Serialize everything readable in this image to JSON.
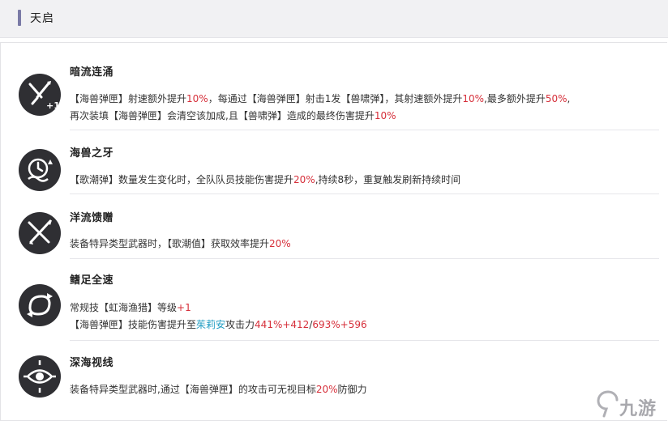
{
  "section": {
    "title": "天启"
  },
  "skills": [
    {
      "name": "暗流连涌",
      "icon": "torpedo-plus-one-icon",
      "lines": [
        [
          [
            "【海兽弹匣】射速额外提升",
            ""
          ],
          [
            "10%",
            "red"
          ],
          [
            "，每通过【海兽弹匣】射击1发【兽啸弹】，其射速额外提升",
            ""
          ],
          [
            "10%",
            "red"
          ],
          [
            ",最多额外提升",
            ""
          ],
          [
            "50%",
            "red"
          ],
          [
            ",",
            ""
          ]
        ],
        [
          [
            "再次装填【海兽弹匣】会清空该加成,且【兽啸弹】造成的最终伤害提升",
            ""
          ],
          [
            "10%",
            "red"
          ]
        ]
      ]
    },
    {
      "name": "海兽之牙",
      "icon": "clock-wave-icon",
      "lines": [
        [
          [
            "【歌潮弹】数量发生变化时，全队队员技能伤害提升",
            ""
          ],
          [
            "20%",
            "red"
          ],
          [
            ",持续8秒，重复触发刷新持续时间",
            ""
          ]
        ]
      ]
    },
    {
      "name": "洋流馈赠",
      "icon": "crossed-blades-icon",
      "lines": [
        [
          [
            "装备特异类型武器时，【歌潮值】获取效率提升",
            ""
          ],
          [
            "20%",
            "red"
          ]
        ]
      ]
    },
    {
      "name": "鳍足全速",
      "icon": "swirl-arrows-icon",
      "lines": [
        [
          [
            "常规技【虹海渔猎】等级",
            ""
          ],
          [
            "+1",
            "red"
          ]
        ],
        [
          [
            "【海兽弹匣】技能伤害提升至",
            ""
          ],
          [
            "茱莉安",
            "cyan"
          ],
          [
            "攻击力",
            ""
          ],
          [
            "441%+412",
            "red"
          ],
          [
            "/",
            ""
          ],
          [
            "693%+596",
            "red"
          ]
        ]
      ]
    },
    {
      "name": "深海视线",
      "icon": "eye-target-icon",
      "lines": [
        [
          [
            "装备特异类型武器时,通过【海兽弹匣】的攻击可无视目标",
            ""
          ],
          [
            "20%",
            "red"
          ],
          [
            "防御力",
            ""
          ]
        ]
      ]
    }
  ],
  "watermark": {
    "text": "九游",
    "icon": "jiuyou-logo-icon"
  },
  "colors": {
    "accent_bar": "#7a7aa6",
    "highlight_red": "#d62f3a",
    "highlight_cyan": "#1f9cc2",
    "icon_bg": "#2f2f33"
  }
}
